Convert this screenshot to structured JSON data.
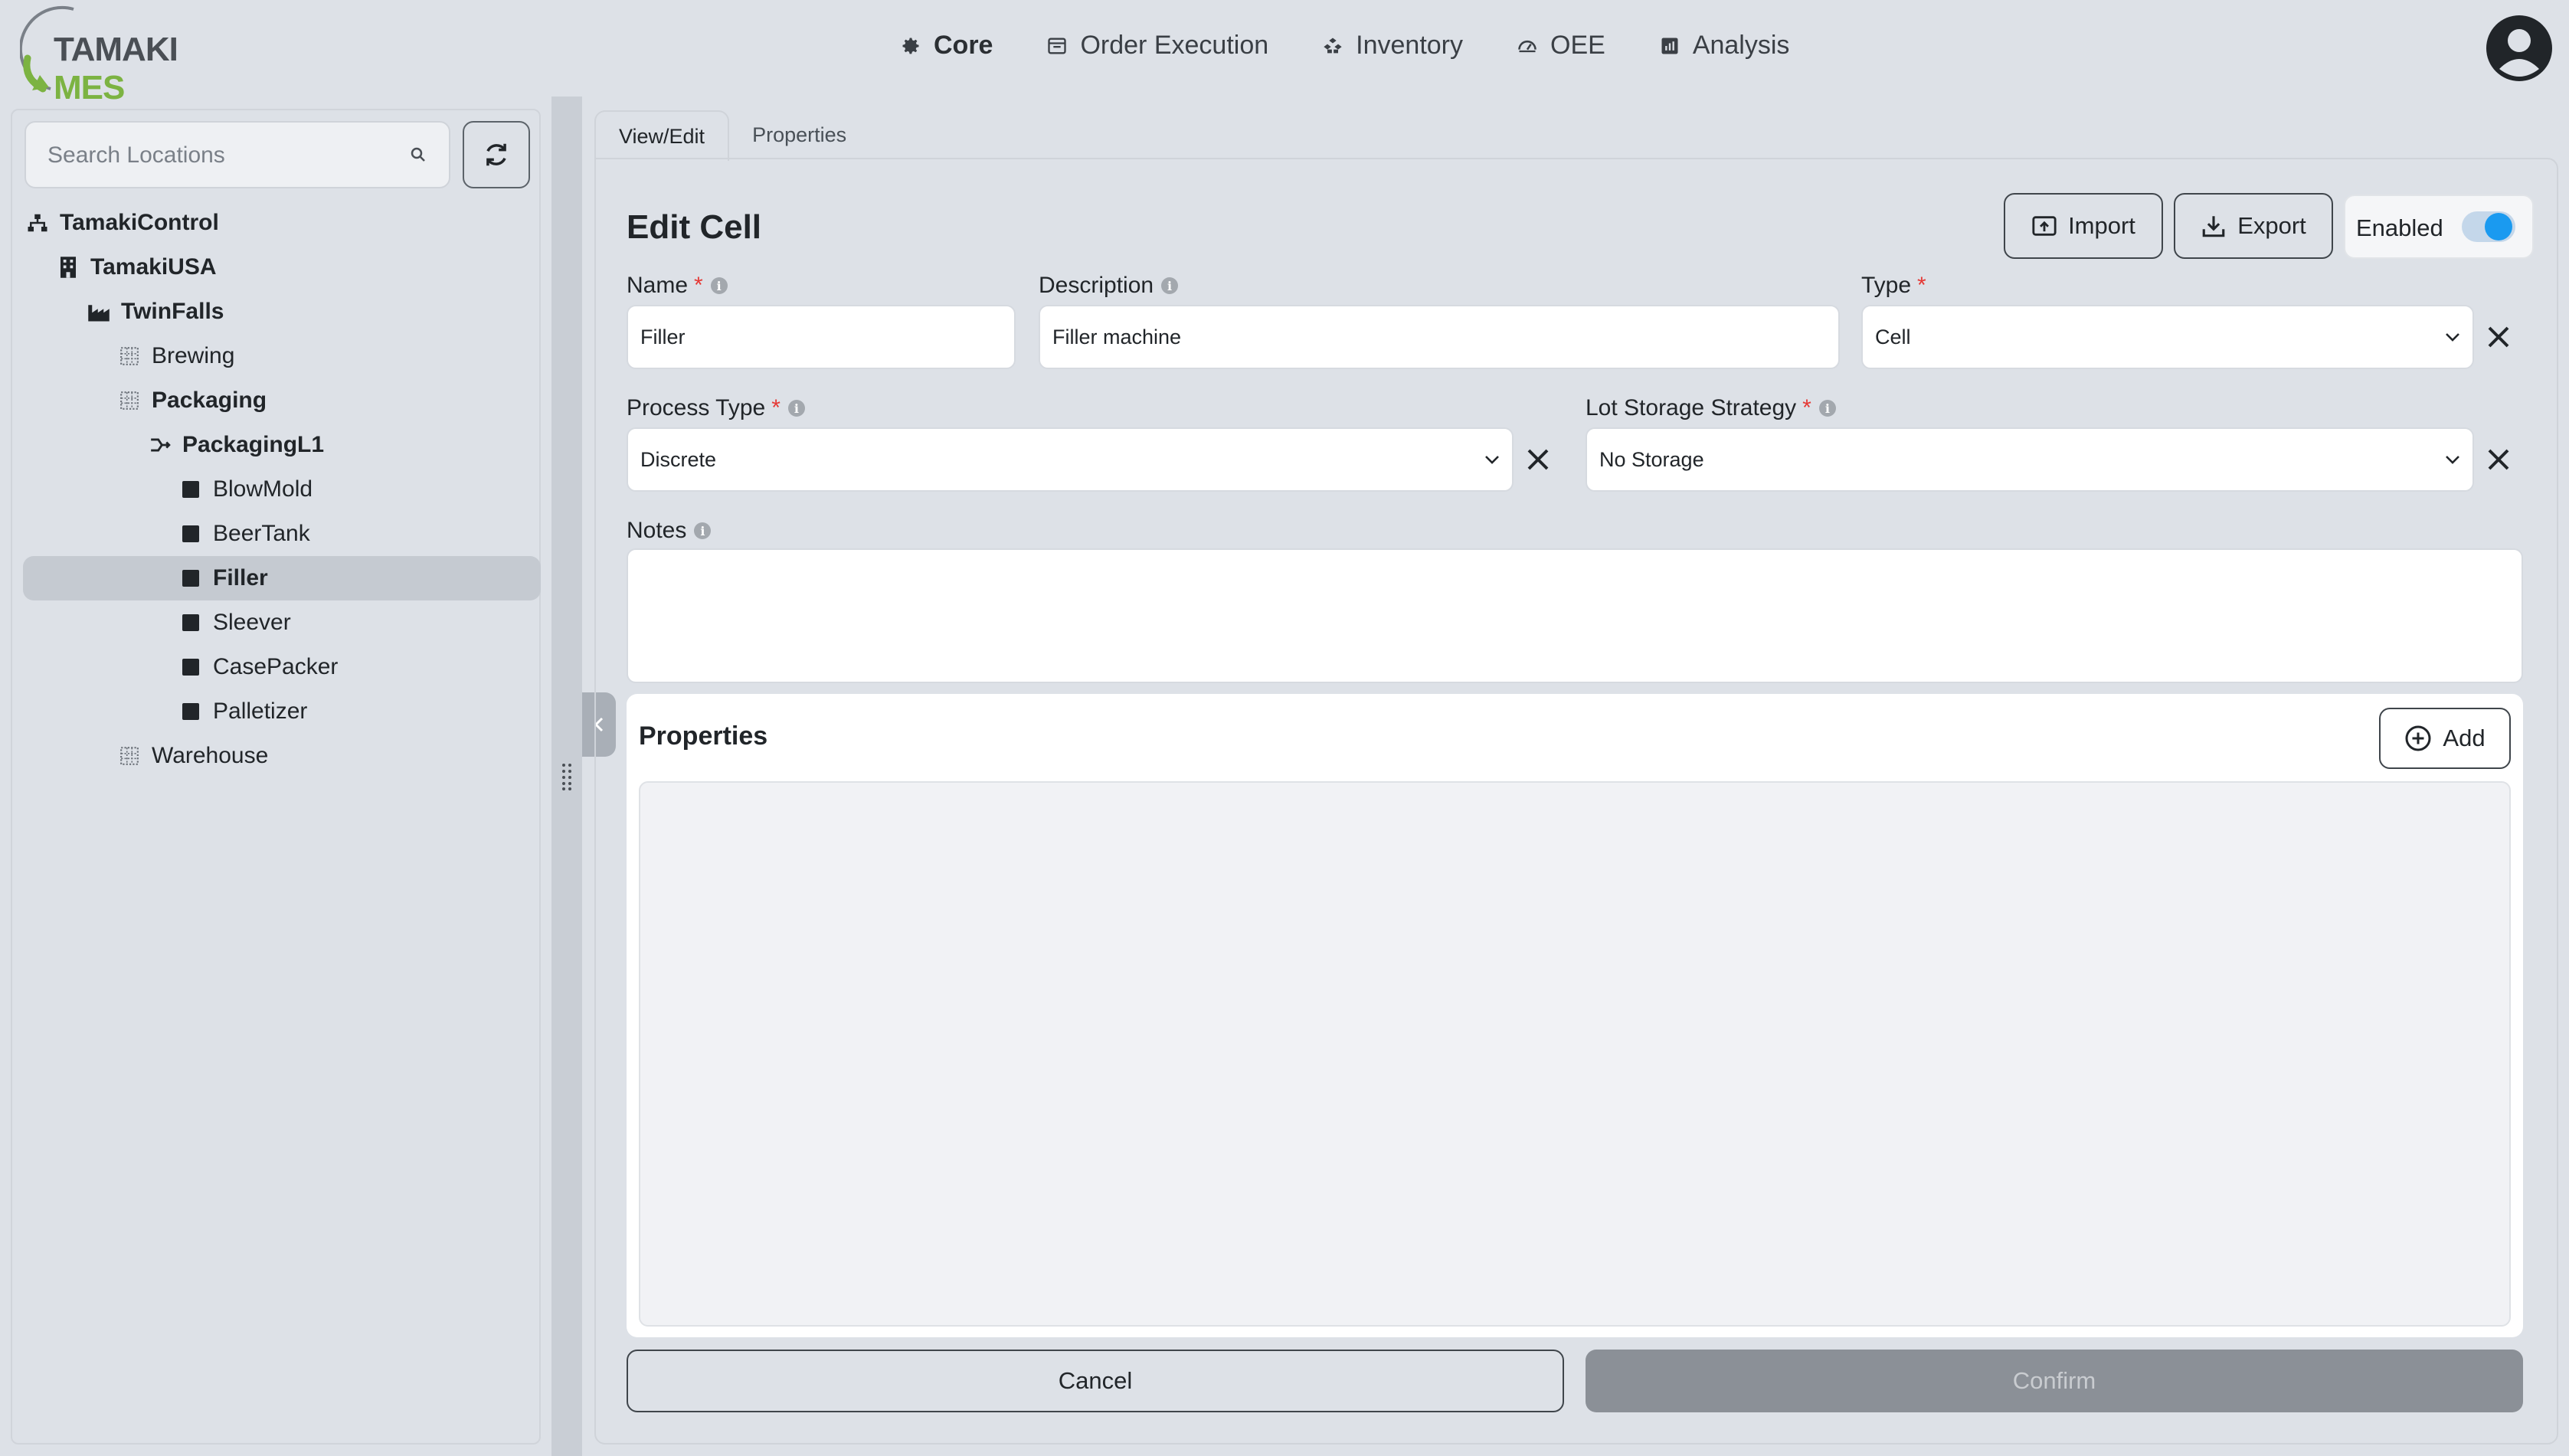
{
  "app": {
    "logo_part1": "TAMAKI",
    "logo_part2": "MES",
    "nav": [
      {
        "label": "Core",
        "icon": "gear-icon",
        "active": true
      },
      {
        "label": "Order Execution",
        "icon": "calendar-icon",
        "active": false
      },
      {
        "label": "Inventory",
        "icon": "boxes-icon",
        "active": false
      },
      {
        "label": "OEE",
        "icon": "speedometer-icon",
        "active": false
      },
      {
        "label": "Analysis",
        "icon": "report-icon",
        "active": false
      }
    ]
  },
  "sidebar": {
    "search_placeholder": "Search Locations",
    "tree": [
      {
        "label": "TamakiControl",
        "level": 0,
        "bold": true,
        "icon": "hierarchy-icon"
      },
      {
        "label": "TamakiUSA",
        "level": 1,
        "bold": true,
        "icon": "building-icon"
      },
      {
        "label": "TwinFalls",
        "level": 2,
        "bold": true,
        "icon": "factory-icon"
      },
      {
        "label": "Brewing",
        "level": 3,
        "bold": false,
        "icon": "grid-icon"
      },
      {
        "label": "Packaging",
        "level": 3,
        "bold": true,
        "icon": "grid-icon"
      },
      {
        "label": "PackagingL1",
        "level": 4,
        "bold": true,
        "icon": "flow-icon"
      },
      {
        "label": "BlowMold",
        "level": 5,
        "bold": false,
        "icon": "square-icon"
      },
      {
        "label": "BeerTank",
        "level": 5,
        "bold": false,
        "icon": "square-icon"
      },
      {
        "label": "Filler",
        "level": 5,
        "bold": true,
        "icon": "square-icon",
        "selected": true
      },
      {
        "label": "Sleever",
        "level": 5,
        "bold": false,
        "icon": "square-icon"
      },
      {
        "label": "CasePacker",
        "level": 5,
        "bold": false,
        "icon": "square-icon"
      },
      {
        "label": "Palletizer",
        "level": 5,
        "bold": false,
        "icon": "square-icon"
      },
      {
        "label": "Warehouse",
        "level": 3,
        "bold": false,
        "icon": "grid-icon"
      }
    ]
  },
  "tabs": {
    "view_edit": "View/Edit",
    "properties": "Properties"
  },
  "form": {
    "title": "Edit Cell",
    "import_label": "Import",
    "export_label": "Export",
    "enabled_label": "Enabled",
    "enabled": true,
    "name_label": "Name",
    "name_value": "Filler",
    "description_label": "Description",
    "description_value": "Filler machine",
    "type_label": "Type",
    "type_value": "Cell",
    "process_type_label": "Process Type",
    "process_type_value": "Discrete",
    "lot_storage_label": "Lot Storage Strategy",
    "lot_storage_value": "No Storage",
    "notes_label": "Notes",
    "notes_value": "",
    "properties_title": "Properties",
    "add_label": "Add",
    "cancel_label": "Cancel",
    "confirm_label": "Confirm"
  },
  "colors": {
    "background": "#dde1e7",
    "accent": "#1a9af0",
    "logo_green": "#7cb342",
    "required": "#e53935",
    "confirm_disabled": "#8b9097"
  }
}
